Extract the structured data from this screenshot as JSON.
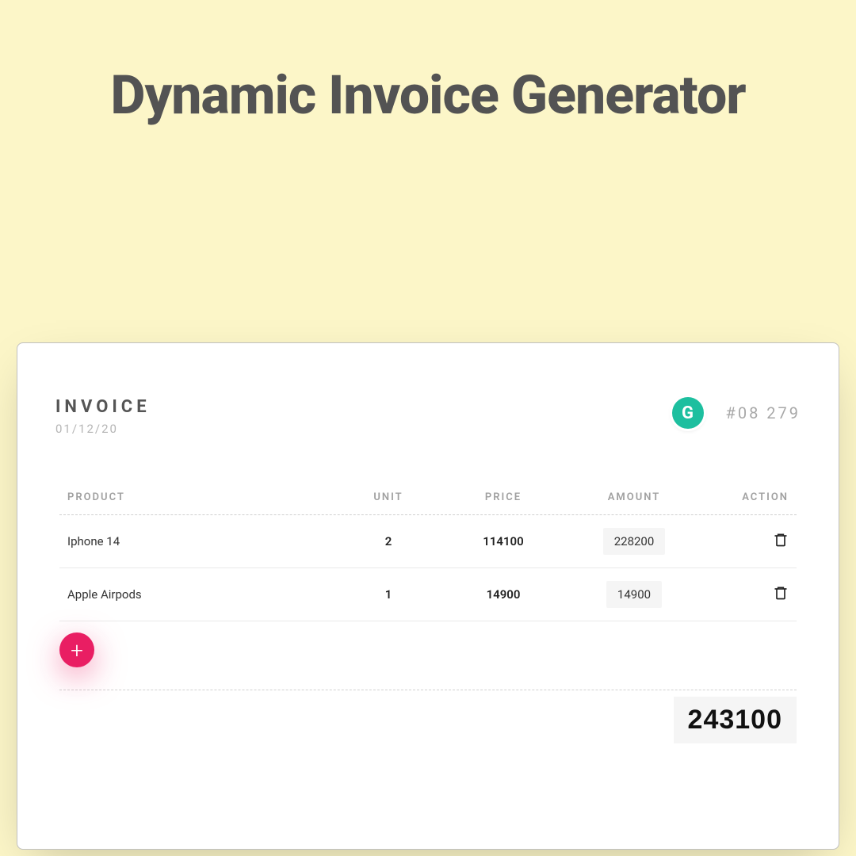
{
  "page_title": "Dynamic Invoice Generator",
  "invoice": {
    "label": "INVOICE",
    "date": "01/12/20",
    "number": "#08 279",
    "badge_letter": "G"
  },
  "columns": {
    "product": "PRODUCT",
    "unit": "UNIT",
    "price": "PRICE",
    "amount": "AMOUNT",
    "action": "ACTION"
  },
  "rows": [
    {
      "product": "Iphone 14",
      "unit": "2",
      "price": "114100",
      "amount": "228200"
    },
    {
      "product": "Apple Airpods",
      "unit": "1",
      "price": "14900",
      "amount": "14900"
    }
  ],
  "total": "243100",
  "add_glyph": "+"
}
